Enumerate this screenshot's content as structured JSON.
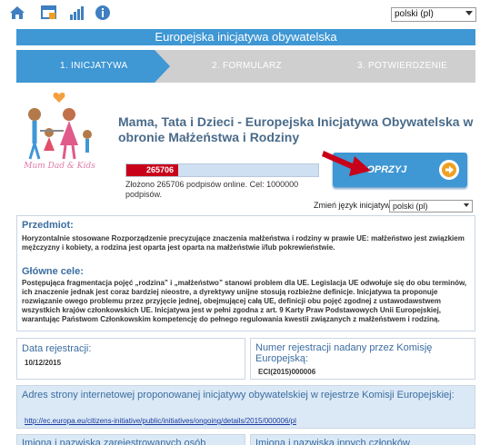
{
  "topbar": {
    "icons": [
      "home-icon",
      "edit-window-icon",
      "bar-chart-icon",
      "info-icon"
    ],
    "language": "polski (pl)"
  },
  "title": "Europejska inicjatywa obywatelska",
  "steps": [
    "1. INICJATYWA",
    "2. FORMULARZ",
    "3. POTWIERDZENIE"
  ],
  "logo": {
    "text": "Mum Dad & Kids"
  },
  "headline": "Mama, Tata i Dzieci - Europejska Inicjatywa Obywatelska w obronie Małżeństwa i Rodziny",
  "progress": {
    "signatures": "265706",
    "fraction": 0.27,
    "info": "Złożono 265706 podpisów online. Cel: 1000000 podpisów."
  },
  "support_button": {
    "label": "POPRZYJ"
  },
  "change_language": {
    "label": "Zmień język inicjatywy:",
    "value": "polski (pl)"
  },
  "subject": {
    "heading": "Przedmiot:",
    "text": "Horyzontalnie stosowane Rozporządzenie precyzujące znaczenia małżeństwa i rodziny w prawie UE: małżeństwo jest związkiem mężczyzny i kobiety, a rodzina jest oparta jest oparta na małżeństwie i/lub pokrewieństwie."
  },
  "goals": {
    "heading": "Główne cele:",
    "text": "Postępująca fragmentacja pojęć „rodzina” i „małżeństwo” stanowi problem dla UE. Legislacja UE odwołuje się do obu terminów, ich znaczenie jednak jest coraz bardziej nieostre, a dyrektywy unijne stosują rozbieżne definicje. Inicjatywa ta proponuje rozwiązanie owego problemu przez przyjęcie jednej, obejmującej całą UE, definicji obu pojęć zgodnej z ustawodawstwem wszystkich krajów członkowskich UE. Inicjatywa jest w pełni zgodna z art. 9 Karty Praw Podstawowych Unii Europejskiej, warantując Państwom Członkowskim kompetencję do pełnego regulowania kwestii związanych z małżeństwem i rodziną."
  },
  "registration_date": {
    "heading": "Data rejestracji:",
    "value": "10/12/2015"
  },
  "registration_number": {
    "heading": "Numer rejestracji nadany przez Komisję Europejską:",
    "value": "ECI(2015)000006"
  },
  "register_url": {
    "heading": "Adres strony internetowej proponowanej inicjatywy obywatelskiej w rejestrze Komisji Europejskiej:",
    "url": "http://ec.europa.eu/citizens-initiative/public/initiatives/ongoing/details/2015/000006/pl"
  },
  "bottom": {
    "left": "Imiona i nazwiska zarejestrowanych osób",
    "right": "Imiona i nazwiska innych członków"
  }
}
